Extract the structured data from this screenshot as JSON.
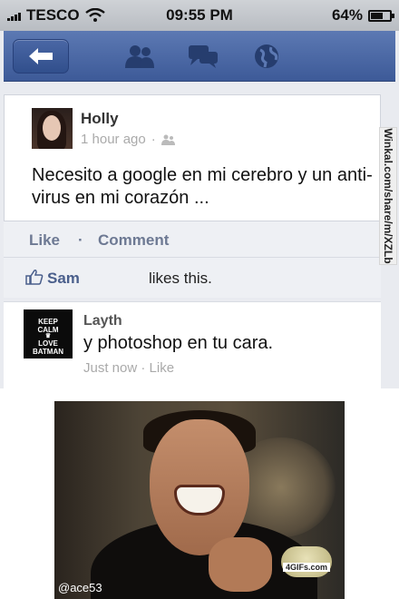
{
  "status_bar": {
    "carrier": "TESCO",
    "time": "09:55 PM",
    "battery": "64%"
  },
  "nav": {
    "back": "back-arrow-icon",
    "icons": [
      "friends-icon",
      "messages-icon",
      "globe-icon"
    ],
    "color": "#3d5a98"
  },
  "post": {
    "author": "Holly",
    "time": "1 hour ago",
    "text": "Necesito a google en mi cerebro y un anti-virus en mi corazón ..."
  },
  "actions": {
    "like": "Like",
    "separator": "·",
    "comment": "Comment"
  },
  "likes": {
    "name": "Sam",
    "suffix": "likes this."
  },
  "comment": {
    "author": "Layth",
    "text": "y photoshop en tu cara.",
    "time": "Just now",
    "like": "Like",
    "avatar_text": [
      "KEEP",
      "CALM",
      "LOVE",
      "BATMAN"
    ]
  },
  "watermark": "Winkal.com/share/m/XZLb",
  "photo": {
    "logo": "4GIFs.com",
    "credit": "@ace53"
  }
}
